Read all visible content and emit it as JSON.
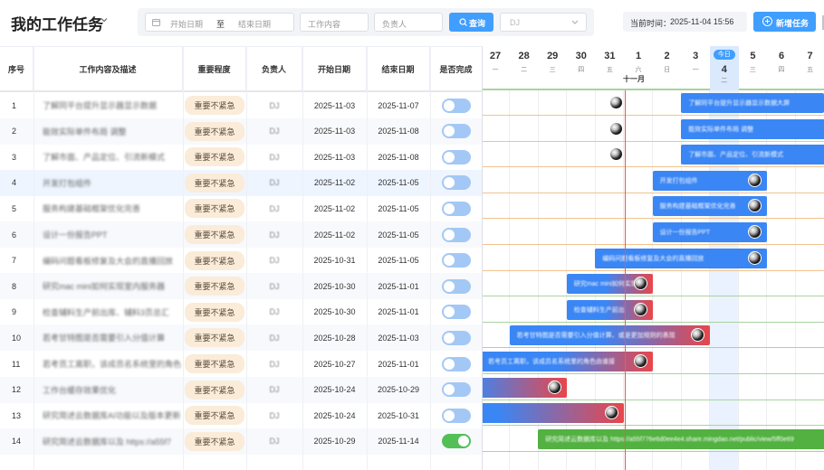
{
  "header": {
    "title": "我的工作任务",
    "filters": {
      "start_placeholder": "开始日期",
      "to_label": "至",
      "end_placeholder": "结束日期",
      "content_placeholder": "工作内容",
      "owner_placeholder": "负责人",
      "query_label": "查询",
      "select_value": "DJ"
    },
    "current_time_label": "当前时间：",
    "current_time_value": "2025-11-04 15:56",
    "new_task_label": "新增任务"
  },
  "table": {
    "columns": [
      "序号",
      "工作内容及描述",
      "重要程度",
      "负责人",
      "开始日期",
      "结束日期",
      "是否完成"
    ],
    "rows": [
      {
        "idx": "1",
        "desc": "了解同平台提升显示器显示数据",
        "priority": "重要不紧急",
        "owner": "DJ",
        "start": "2025-11-03",
        "end": "2025-11-07",
        "done": false
      },
      {
        "idx": "2",
        "desc": "能效实际单件布局 调整",
        "priority": "重要不紧急",
        "owner": "DJ",
        "start": "2025-11-03",
        "end": "2025-11-08",
        "done": false
      },
      {
        "idx": "3",
        "desc": "了解市面、产品定位、引流新模式",
        "priority": "重要不紧急",
        "owner": "DJ",
        "start": "2025-11-03",
        "end": "2025-11-08",
        "done": false
      },
      {
        "idx": "4",
        "desc": "开发打包组件",
        "priority": "重要不紧急",
        "owner": "DJ",
        "start": "2025-11-02",
        "end": "2025-11-05",
        "done": false
      },
      {
        "idx": "5",
        "desc": "服务构建基础框架优化完善",
        "priority": "重要不紧急",
        "owner": "DJ",
        "start": "2025-11-02",
        "end": "2025-11-05",
        "done": false
      },
      {
        "idx": "6",
        "desc": "设计一份报告PPT",
        "priority": "重要不紧急",
        "owner": "DJ",
        "start": "2025-11-02",
        "end": "2025-11-05",
        "done": false
      },
      {
        "idx": "7",
        "desc": "编码问题看板修复及大会的直播回放",
        "priority": "重要不紧急",
        "owner": "DJ",
        "start": "2025-10-31",
        "end": "2025-11-05",
        "done": false
      },
      {
        "idx": "8",
        "desc": "研究mac mini如何实现室内服务器",
        "priority": "重要不紧急",
        "owner": "DJ",
        "start": "2025-10-30",
        "end": "2025-11-01",
        "done": false
      },
      {
        "idx": "9",
        "desc": "检查辅料生产前出库、辅料3页总汇",
        "priority": "重要不紧急",
        "owner": "DJ",
        "start": "2025-10-30",
        "end": "2025-11-01",
        "done": false
      },
      {
        "idx": "10",
        "desc": "若考甘特图是否需要引入分值计算",
        "priority": "重要不紧急",
        "owner": "DJ",
        "start": "2025-10-28",
        "end": "2025-11-03",
        "done": false
      },
      {
        "idx": "11",
        "desc": "若考员工离职，该成员名系统里的角色",
        "priority": "重要不紧急",
        "owner": "DJ",
        "start": "2025-10-27",
        "end": "2025-11-01",
        "done": false
      },
      {
        "idx": "12",
        "desc": "工作台缓存效果优化",
        "priority": "重要不紧急",
        "owner": "DJ",
        "start": "2025-10-24",
        "end": "2025-10-29",
        "done": false
      },
      {
        "idx": "13",
        "desc": "研究简述云数据库AI功能以及版本更新",
        "priority": "重要不紧急",
        "owner": "DJ",
        "start": "2025-10-24",
        "end": "2025-10-31",
        "done": false
      },
      {
        "idx": "14",
        "desc": "研究简述云数据库以及 https://a55f7",
        "priority": "重要不紧急",
        "owner": "DJ",
        "start": "2025-10-29",
        "end": "2025-11-14",
        "done": true
      }
    ]
  },
  "gantt": {
    "month_label": "十一月",
    "today_label": "今日",
    "days": [
      {
        "num": "27",
        "wk": "一"
      },
      {
        "num": "28",
        "wk": "二"
      },
      {
        "num": "29",
        "wk": "三"
      },
      {
        "num": "30",
        "wk": "四"
      },
      {
        "num": "31",
        "wk": "五"
      },
      {
        "num": "1",
        "wk": "六"
      },
      {
        "num": "2",
        "wk": "日"
      },
      {
        "num": "3",
        "wk": "一"
      },
      {
        "num": "4",
        "wk": "二"
      },
      {
        "num": "5",
        "wk": "三"
      },
      {
        "num": "6",
        "wk": "四"
      },
      {
        "num": "7",
        "wk": "五"
      }
    ],
    "today_index": 8,
    "bars": [
      {
        "row": 1,
        "label": "了解同平台提升显示器显示数据大屏",
        "color": "#3a86f5",
        "color2": "#3a86f5"
      },
      {
        "row": 2,
        "label": "能效实际单件布局 调整",
        "color": "#3a86f5",
        "color2": "#3a86f5"
      },
      {
        "row": 3,
        "label": "了解市面、产品定位、引流新模式",
        "color": "#3a86f5",
        "color2": "#3a86f5"
      },
      {
        "row": 4,
        "label": "开发打包组件",
        "color": "#3a86f5",
        "color2": "#3a86f5"
      },
      {
        "row": 5,
        "label": "服务构建基础框架优化完善",
        "color": "#3a86f5",
        "color2": "#3a86f5"
      },
      {
        "row": 6,
        "label": "设计一份报告PPT",
        "color": "#3a86f5",
        "color2": "#3a86f5"
      },
      {
        "row": 7,
        "label": "编码问题看板修复及大会的直播回放",
        "color": "#3a86f5",
        "color2": "#3a86f5"
      },
      {
        "row": 8,
        "label": "研究mac mini如何实现",
        "color": "#3a86f5",
        "color2": "#e8464a"
      },
      {
        "row": 9,
        "label": "检查辅料生产前出",
        "color": "#3a86f5",
        "color2": "#e8464a"
      },
      {
        "row": 10,
        "label": "若考甘特图是否需要引入分值计算、或是更加规则的表现",
        "color": "#3a86f5",
        "color2": "#e8464a"
      },
      {
        "row": 11,
        "label": "若考员工离职，该成员名系统里的角色由谁接",
        "color": "#3a86f5",
        "color2": "#e8464a"
      },
      {
        "row": 12,
        "label": "",
        "color": "#3a86f5",
        "color2": "#e8464a"
      },
      {
        "row": 13,
        "label": "及版本更新的内容",
        "color": "#3a86f5",
        "color2": "#e8464a"
      },
      {
        "row": 14,
        "label": "研究简述云数据库以及 https://a55f776e6d0ee4e4.share.mingdao.net/public/view/5ff0e69",
        "color": "#52b140",
        "color2": "#52b140"
      }
    ]
  }
}
